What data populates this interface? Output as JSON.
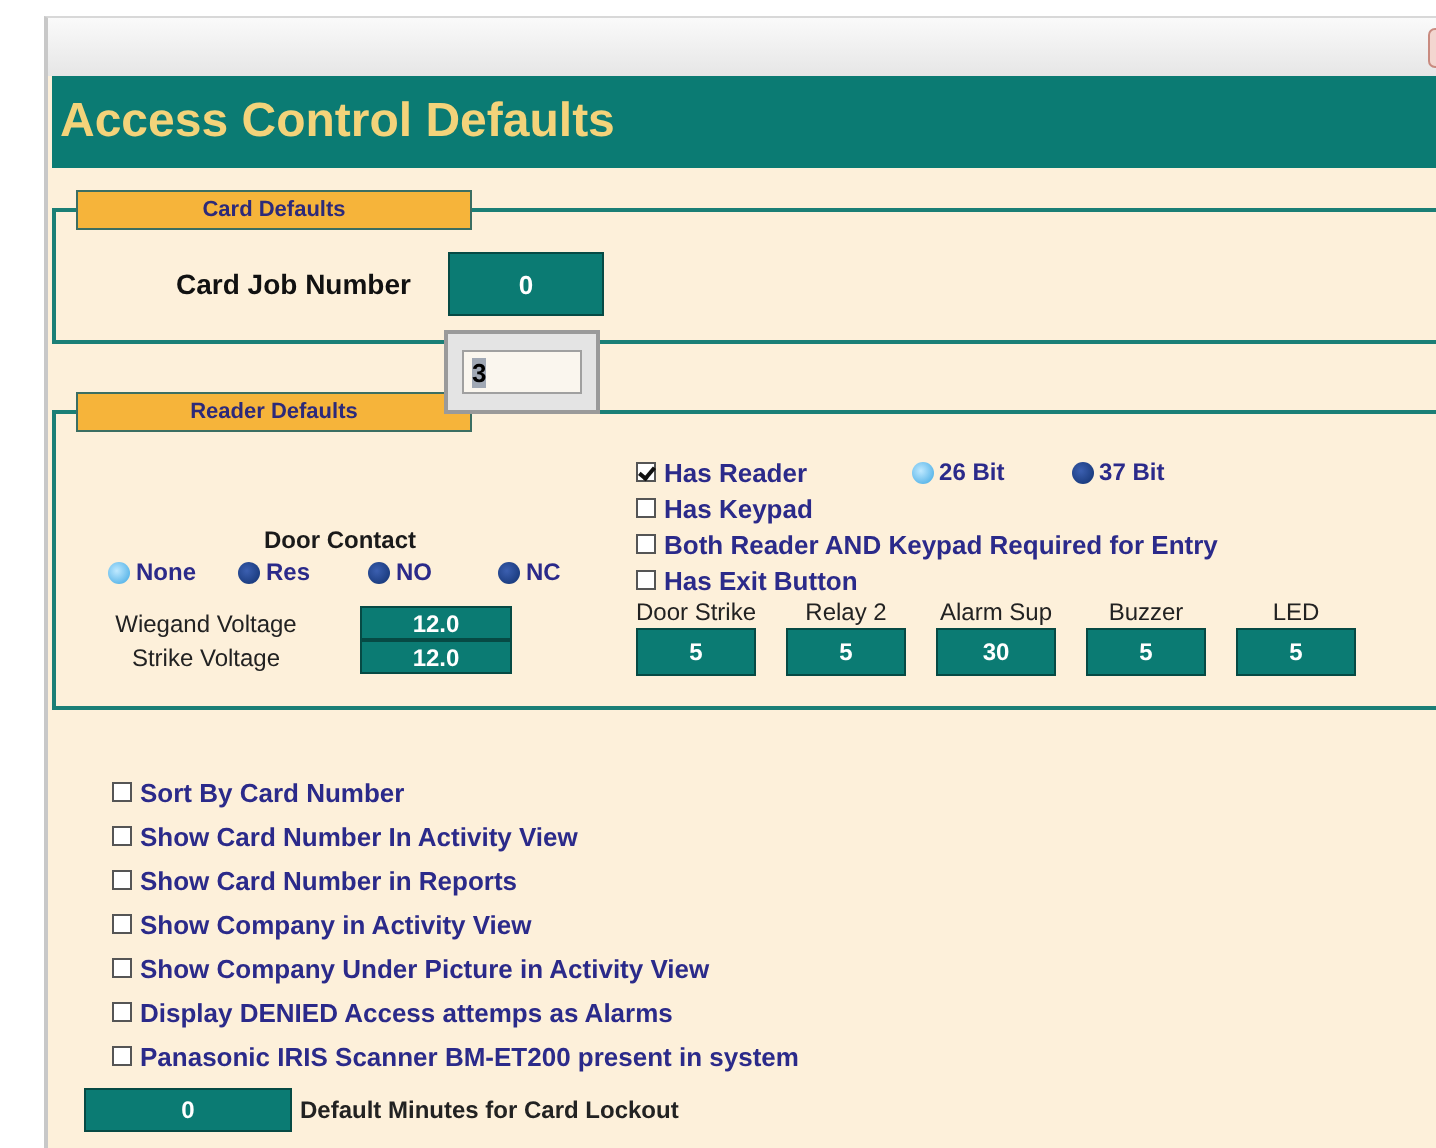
{
  "title": "Access Control Defaults",
  "card_defaults": {
    "legend": "Card Defaults",
    "job_number_label": "Card Job Number",
    "job_number": "0"
  },
  "edit_popup": {
    "value": "3"
  },
  "reader_defaults": {
    "legend": "Reader Defaults",
    "door_contact": {
      "label": "Door Contact",
      "options": [
        {
          "label": "None",
          "selected": true
        },
        {
          "label": "Res",
          "selected": false
        },
        {
          "label": "NO",
          "selected": false
        },
        {
          "label": "NC",
          "selected": false
        }
      ]
    },
    "voltages": [
      {
        "label": "Wiegand Voltage",
        "value": "12.0"
      },
      {
        "label": "Strike Voltage",
        "value": "12.0"
      }
    ],
    "checkboxes": [
      {
        "label": "Has Reader",
        "checked": true
      },
      {
        "label": "Has Keypad",
        "checked": false
      },
      {
        "label": "Both Reader AND Keypad Required for Entry",
        "checked": false
      },
      {
        "label": "Has Exit Button",
        "checked": false
      }
    ],
    "bit_formats": [
      {
        "label": "26 Bit",
        "selected": true
      },
      {
        "label": "37 Bit",
        "selected": false
      }
    ],
    "timers": [
      {
        "label": "Door Strike",
        "value": "5"
      },
      {
        "label": "Relay 2",
        "value": "5"
      },
      {
        "label": "Alarm Sup",
        "value": "30"
      },
      {
        "label": "Buzzer",
        "value": "5"
      },
      {
        "label": "LED",
        "value": "5"
      }
    ]
  },
  "options": [
    {
      "label": "Sort By Card Number",
      "checked": false
    },
    {
      "label": "Show Card Number In Activity View",
      "checked": false
    },
    {
      "label": "Show Card Number in Reports",
      "checked": false
    },
    {
      "label": "Show Company in Activity View",
      "checked": false
    },
    {
      "label": "Show Company Under Picture in Activity View",
      "checked": false
    },
    {
      "label": "Display DENIED Access attemps as Alarms",
      "checked": false
    },
    {
      "label": "Panasonic IRIS Scanner BM-ET200 present in system",
      "checked": false
    }
  ],
  "lockout": {
    "value": "0",
    "label": "Default Minutes for Card Lockout"
  }
}
